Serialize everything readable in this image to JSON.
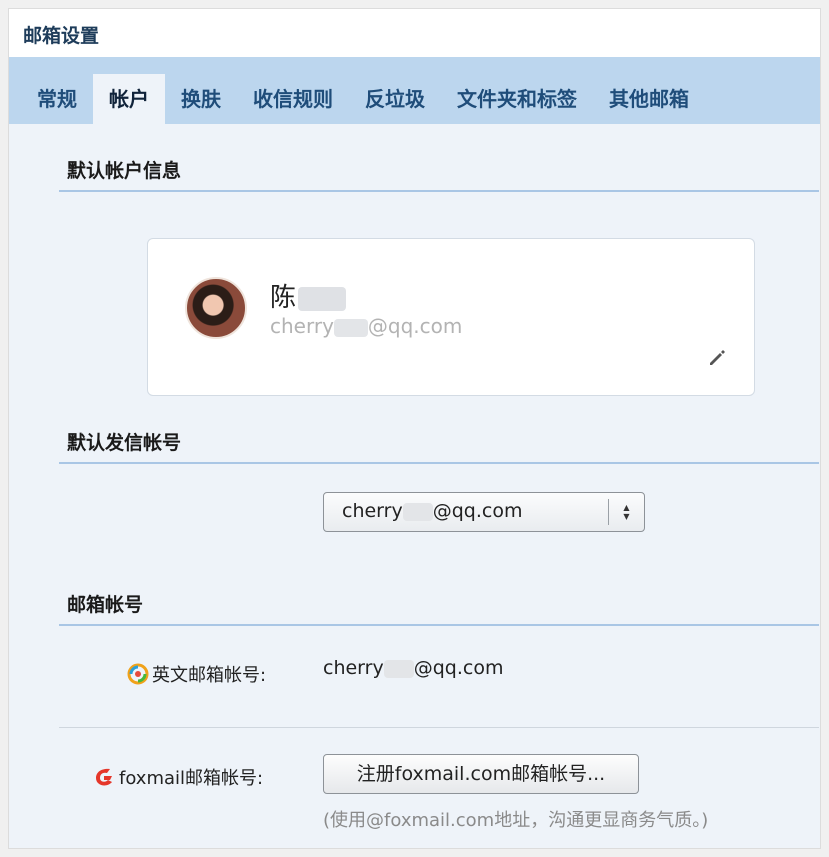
{
  "window": {
    "title": "邮箱设置"
  },
  "tabs": [
    {
      "label": "常规",
      "active": false
    },
    {
      "label": "帐户",
      "active": true
    },
    {
      "label": "换肤",
      "active": false
    },
    {
      "label": "收信规则",
      "active": false
    },
    {
      "label": "反垃圾",
      "active": false
    },
    {
      "label": "文件夹和标签",
      "active": false
    },
    {
      "label": "其他邮箱",
      "active": false
    }
  ],
  "default_account": {
    "section_title": "默认帐户信息",
    "name": "陈",
    "email_prefix": "cherry",
    "email_suffix": "@qq.com",
    "edit_icon": "pencil-icon"
  },
  "default_sender": {
    "section_title": "默认发信帐号",
    "selected_prefix": "cherry",
    "selected_suffix": "@qq.com"
  },
  "mail_accounts": {
    "section_title": "邮箱帐号",
    "english_label": "英文邮箱帐号:",
    "english_icon": "qq-mail-icon",
    "english_value_prefix": "cherry",
    "english_value_suffix": "@qq.com",
    "foxmail_label": "foxmail邮箱帐号:",
    "foxmail_icon": "foxmail-icon",
    "register_button": "注册foxmail.com邮箱帐号...",
    "note": "(使用@foxmail.com地址，沟通更显商务气质。)"
  },
  "colors": {
    "tab_bar": "#bcd6ee",
    "content_bg": "#eef3f9",
    "section_rule": "#a9c6e5"
  }
}
